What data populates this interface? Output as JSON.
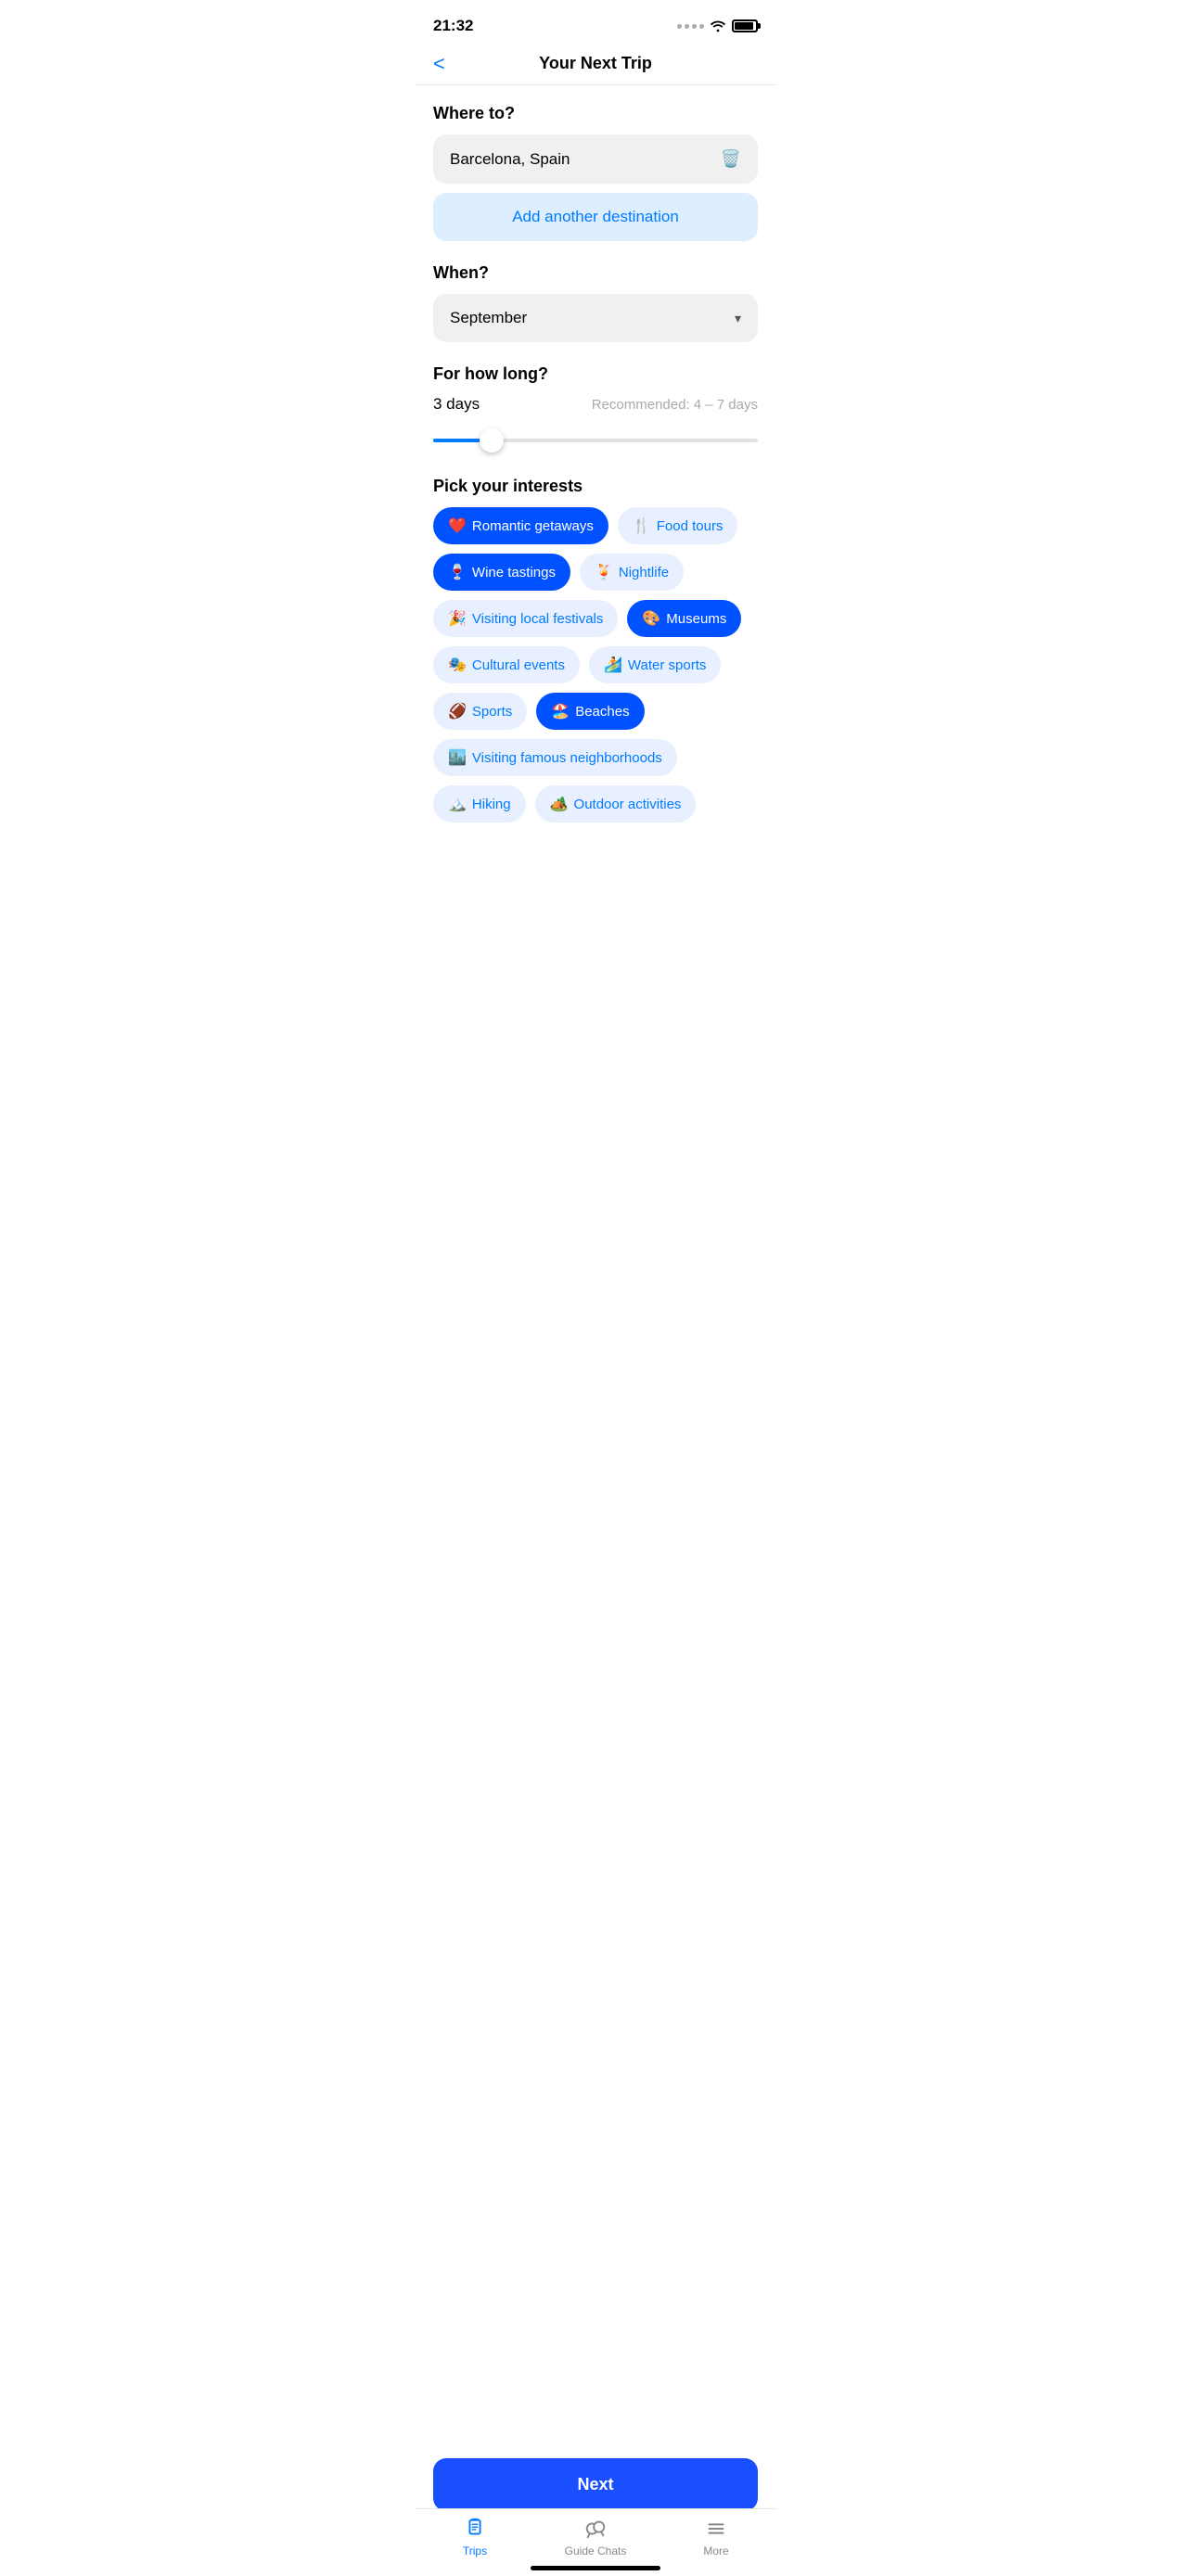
{
  "statusBar": {
    "time": "21:32"
  },
  "header": {
    "title": "Your Next Trip",
    "backLabel": "<"
  },
  "whereTo": {
    "label": "Where to?",
    "destination": "Barcelona, Spain",
    "addDestinationLabel": "Add another destination",
    "trashIconLabel": "🗑"
  },
  "when": {
    "label": "When?",
    "selectedMonth": "September"
  },
  "duration": {
    "label": "For how long?",
    "value": "3 days",
    "recommended": "Recommended: 4 – 7 days",
    "sliderMin": 1,
    "sliderMax": 14,
    "sliderCurrent": 3
  },
  "interests": {
    "label": "Pick your interests",
    "chips": [
      {
        "id": "romantic",
        "emoji": "❤️",
        "label": "Romantic getaways",
        "selected": true
      },
      {
        "id": "food",
        "emoji": "🍴",
        "label": "Food tours",
        "selected": false
      },
      {
        "id": "wine",
        "emoji": "🍷",
        "label": "Wine tastings",
        "selected": true
      },
      {
        "id": "nightlife",
        "emoji": "🍹",
        "label": "Nightlife",
        "selected": false
      },
      {
        "id": "festivals",
        "emoji": "🎉",
        "label": "Visiting local festivals",
        "selected": false
      },
      {
        "id": "museums",
        "emoji": "🎨",
        "label": "Museums",
        "selected": true
      },
      {
        "id": "cultural",
        "emoji": "🎭",
        "label": "Cultural events",
        "selected": false
      },
      {
        "id": "watersports",
        "emoji": "🏄",
        "label": "Water sports",
        "selected": false
      },
      {
        "id": "sports",
        "emoji": "🏈",
        "label": "Sports",
        "selected": false
      },
      {
        "id": "beaches",
        "emoji": "🏖️",
        "label": "Beaches",
        "selected": true
      },
      {
        "id": "neighborhoods",
        "emoji": "🏙️",
        "label": "Visiting famous neighborhoods",
        "selected": false
      },
      {
        "id": "hiking",
        "emoji": "🏔️",
        "label": "Hiking",
        "selected": false
      },
      {
        "id": "outdoor",
        "emoji": "🏕️",
        "label": "Outdoor activities",
        "selected": false
      }
    ]
  },
  "nextButton": {
    "label": "Next"
  },
  "tabBar": {
    "tabs": [
      {
        "id": "trips",
        "label": "Trips",
        "active": true
      },
      {
        "id": "guide-chats",
        "label": "Guide Chats",
        "active": false
      },
      {
        "id": "more",
        "label": "More",
        "active": false
      }
    ]
  }
}
